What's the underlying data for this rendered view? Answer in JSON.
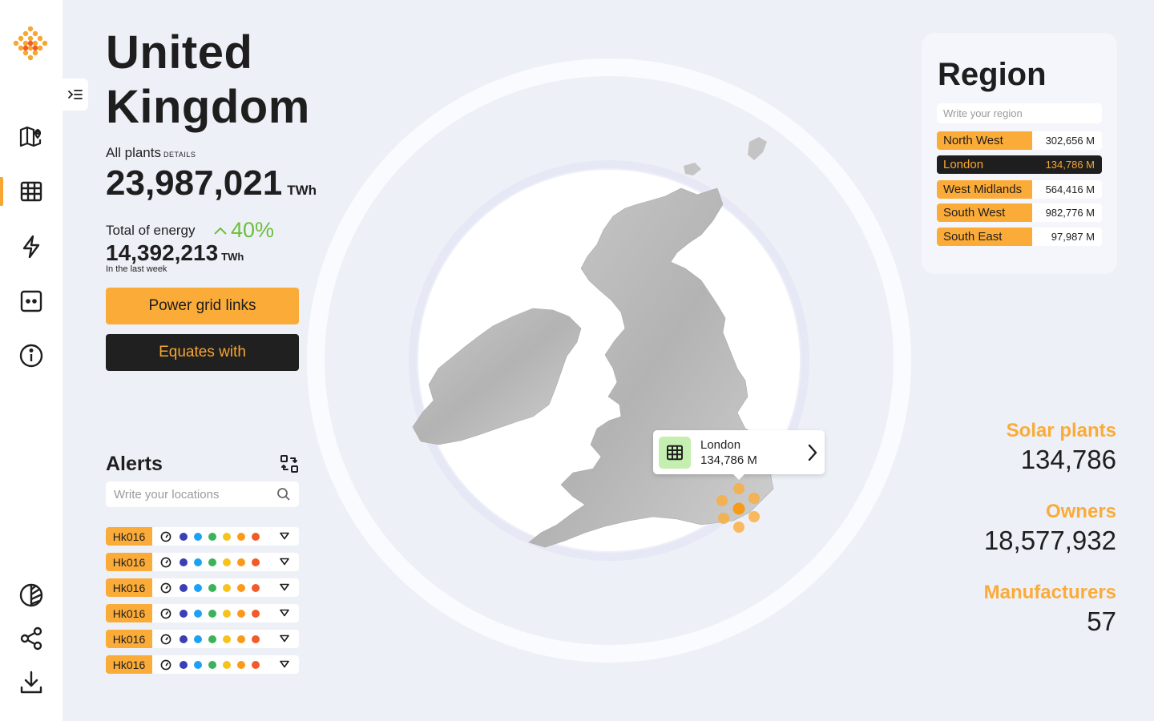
{
  "nav": {
    "items": [
      {
        "icon": "map-pin-icon"
      },
      {
        "icon": "solar-panel-icon",
        "active": true
      },
      {
        "icon": "lightning-icon"
      },
      {
        "icon": "device-icon"
      },
      {
        "icon": "info-icon"
      }
    ],
    "bottom": [
      {
        "icon": "theme-toggle-icon"
      },
      {
        "icon": "share-icon"
      },
      {
        "icon": "download-icon"
      }
    ]
  },
  "header": {
    "title_line1": "United",
    "title_line2": "Kingdom"
  },
  "summary": {
    "all_plants_label": "All plants",
    "details_label": "DETAILS",
    "all_plants_value": "23,987,021",
    "all_plants_unit": "TWh",
    "energy_label": "Total of energy",
    "energy_change": "40%",
    "energy_value": "14,392,213",
    "energy_unit": "TWh",
    "energy_period": "In the last week"
  },
  "buttons": {
    "power_grid": "Power grid links",
    "equates": "Equates with"
  },
  "alerts": {
    "title": "Alerts",
    "search_placeholder": "Write your locations",
    "rows": [
      {
        "tag": "Hk016"
      },
      {
        "tag": "Hk016"
      },
      {
        "tag": "Hk016"
      },
      {
        "tag": "Hk016"
      },
      {
        "tag": "Hk016"
      },
      {
        "tag": "Hk016"
      }
    ],
    "dot_colors": [
      "#3b3fb5",
      "#1da1f2",
      "#3cb35a",
      "#f8c21e",
      "#fb9a1a",
      "#f25a2a"
    ]
  },
  "tooltip": {
    "name": "London",
    "value": "134,786 M"
  },
  "region": {
    "title": "Region",
    "search_placeholder": "Write your region",
    "rows": [
      {
        "name": "North West",
        "value": "302,656 M"
      },
      {
        "name": "London",
        "value": "134,786 M",
        "selected": true
      },
      {
        "name": "West Midlands",
        "value": "564,416 M"
      },
      {
        "name": "South West",
        "value": "982,776 M"
      },
      {
        "name": "South East",
        "value": "97,987 M"
      }
    ]
  },
  "stats": {
    "solar_label": "Solar plants",
    "solar_value": "134,786",
    "owners_label": "Owners",
    "owners_value": "18,577,932",
    "manufacturers_label": "Manufacturers",
    "manufacturers_value": "57"
  },
  "colors": {
    "accent": "#fbab38",
    "dark": "#1e1e1e",
    "positive": "#6cbf3c",
    "background": "#eef0f8"
  }
}
